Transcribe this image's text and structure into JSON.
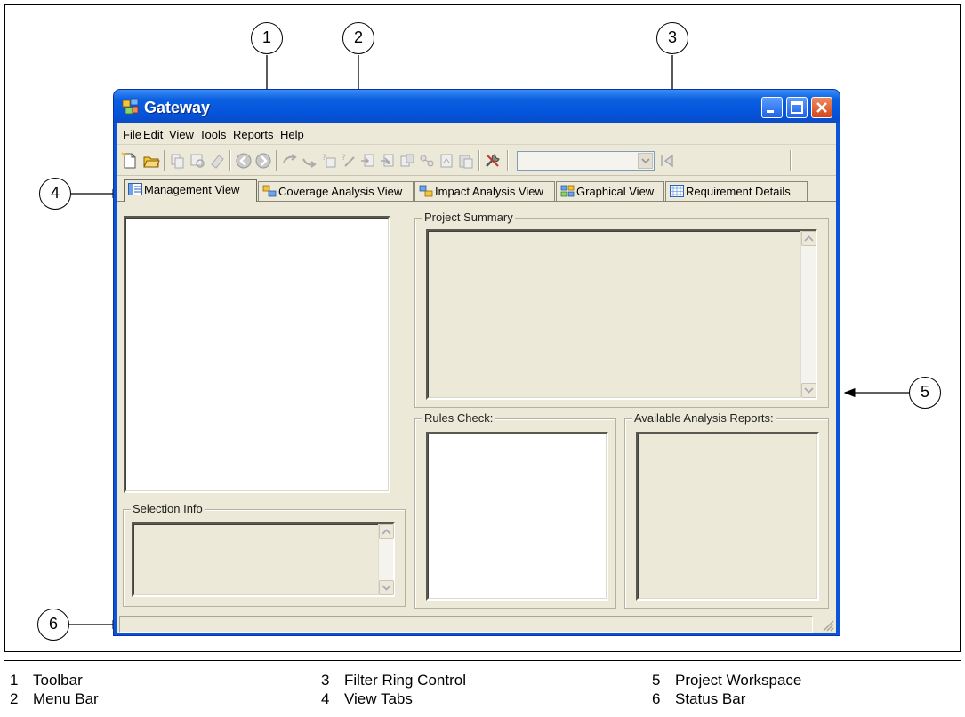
{
  "window": {
    "title": "Gateway"
  },
  "menubar": {
    "items": [
      "File",
      "Edit",
      "View",
      "Tools",
      "Reports",
      "Help"
    ]
  },
  "tabs": [
    {
      "label": "Management View",
      "active": true
    },
    {
      "label": "Coverage Analysis View",
      "active": false
    },
    {
      "label": "Impact Analysis View",
      "active": false
    },
    {
      "label": "Graphical View",
      "active": false
    },
    {
      "label": "Requirement Details",
      "active": false
    }
  ],
  "panels": {
    "selection_info": "Selection Info",
    "project_summary": "Project Summary",
    "rules_check": "Rules Check:",
    "available_reports": "Available Analysis Reports:"
  },
  "callouts": [
    "1",
    "2",
    "3",
    "4",
    "5",
    "6"
  ],
  "legend": [
    {
      "num": "1",
      "label": "Toolbar"
    },
    {
      "num": "2",
      "label": "Menu Bar"
    },
    {
      "num": "3",
      "label": "Filter Ring Control"
    },
    {
      "num": "4",
      "label": "View Tabs"
    },
    {
      "num": "5",
      "label": "Project Workspace"
    },
    {
      "num": "6",
      "label": "Status Bar"
    }
  ],
  "toolbar": {
    "icons": [
      "new-icon",
      "open-icon",
      "copy-icon",
      "filter-icon",
      "clear-icon",
      "back-icon",
      "forward-icon",
      "trace-up-icon",
      "trace-down-icon",
      "add-requirement-icon",
      "add-link-icon",
      "import-icon",
      "export-icon",
      "document-icon",
      "link-icon",
      "report-icon",
      "paste-icon",
      "settings-icon",
      "filter-ring-apply-icon"
    ]
  },
  "colors": {
    "titlebar": "#0a5fe0",
    "client": "#ece9d8",
    "close_button": "#d3451a"
  }
}
